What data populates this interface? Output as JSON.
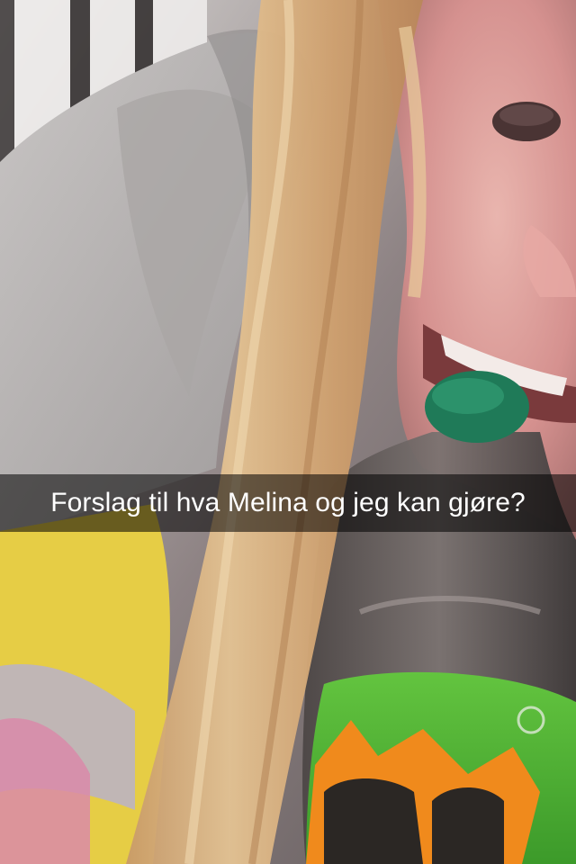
{
  "snap": {
    "caption": "Forslag til hva Melina og jeg kan gjøre?",
    "caption_text_color": "#ffffff",
    "caption_bar_color": "rgba(0,0,0,0.55)"
  },
  "scene": {
    "background": "#7a6f70",
    "hoodie_color": "#b9b6b6",
    "hair_color": "#d7ad78",
    "skin_color": "#d99a99",
    "blanket_color": "#e9d34a",
    "bottle_label_color": "#52b83a",
    "bottle_cap_color": "#1f7a58",
    "label_splash_color": "#f08a1c"
  }
}
